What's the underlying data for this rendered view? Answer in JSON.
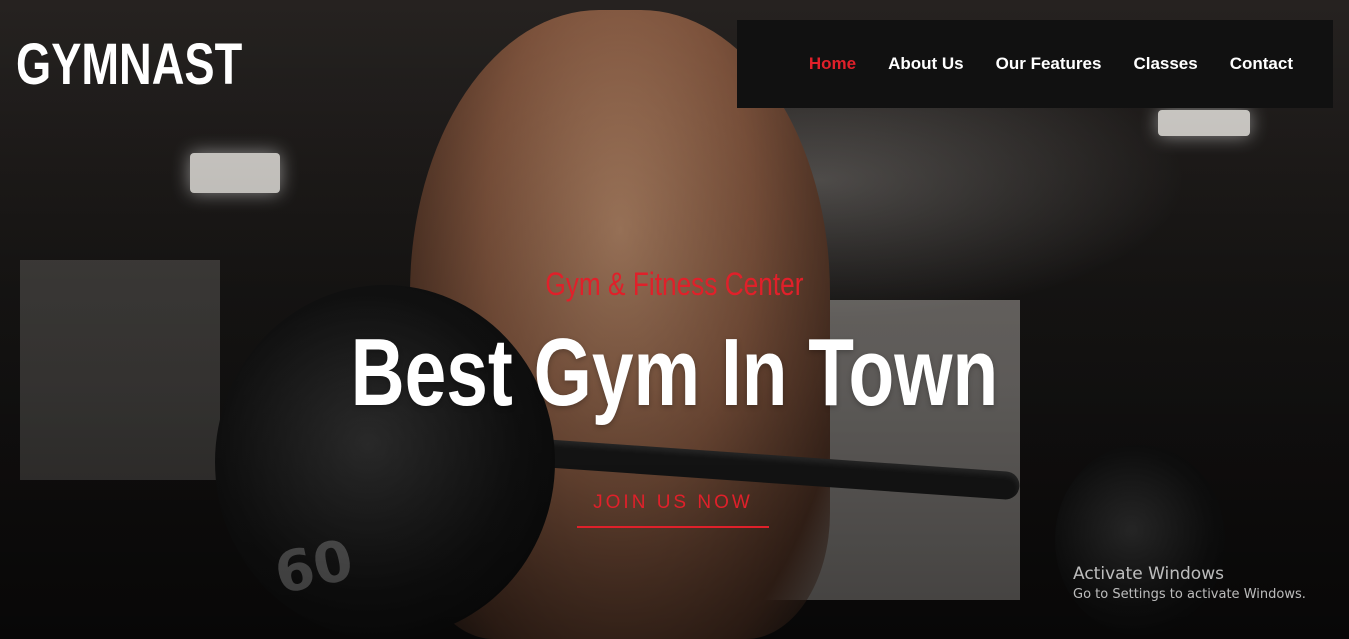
{
  "brand": {
    "logo_text": "GYMNAST"
  },
  "nav": {
    "items": [
      {
        "label": "Home",
        "active": true
      },
      {
        "label": "About Us",
        "active": false
      },
      {
        "label": "Our Features",
        "active": false
      },
      {
        "label": "Classes",
        "active": false
      },
      {
        "label": "Contact",
        "active": false
      }
    ]
  },
  "hero": {
    "subtitle": "Gym & Fitness Center",
    "headline": "Best Gym In Town",
    "cta_label": "JOIN US NOW",
    "plate_text": "60"
  },
  "watermark": {
    "title": "Activate Windows",
    "subtitle": "Go to Settings to activate Windows."
  },
  "colors": {
    "accent": "#e0202a",
    "navbar_bg": "#111111",
    "text": "#ffffff"
  }
}
